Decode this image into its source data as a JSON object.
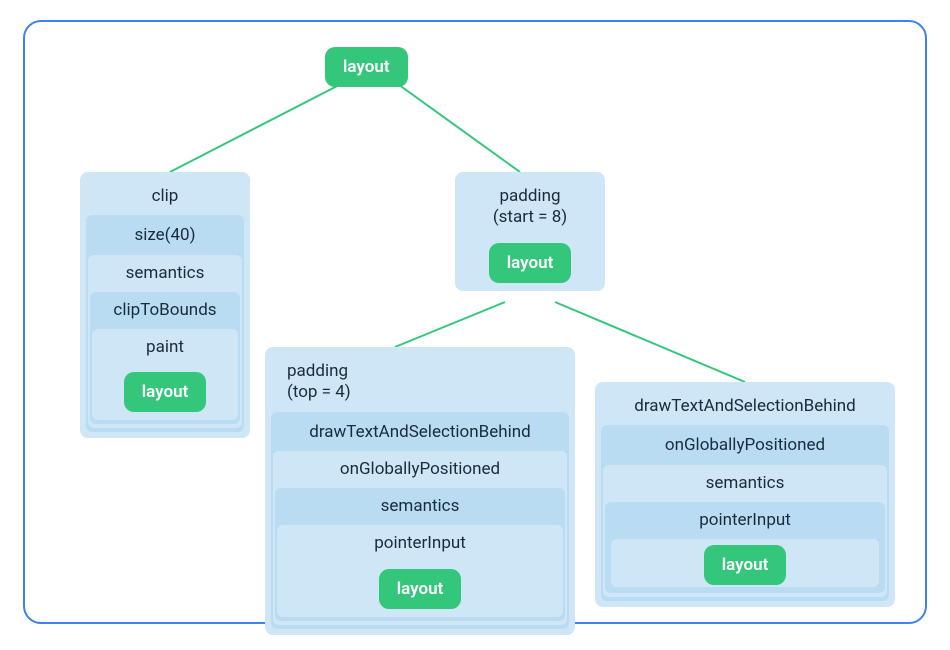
{
  "root": {
    "label": "layout"
  },
  "leftCard": {
    "items": [
      "clip",
      "size(40)",
      "semantics",
      "clipToBounds",
      "paint"
    ],
    "layout": "layout"
  },
  "paddingCard": {
    "line1": "padding",
    "line2": "(start = 8)",
    "layout": "layout"
  },
  "bottomLeft": {
    "header1": "padding",
    "header2": "(top = 4)",
    "items": [
      "drawTextAndSelectionBehind",
      "onGloballyPositioned",
      "semantics",
      "pointerInput"
    ],
    "layout": "layout"
  },
  "bottomRight": {
    "items": [
      "drawTextAndSelectionBehind",
      "onGloballyPositioned",
      "semantics",
      "pointerInput"
    ],
    "layout": "layout"
  }
}
